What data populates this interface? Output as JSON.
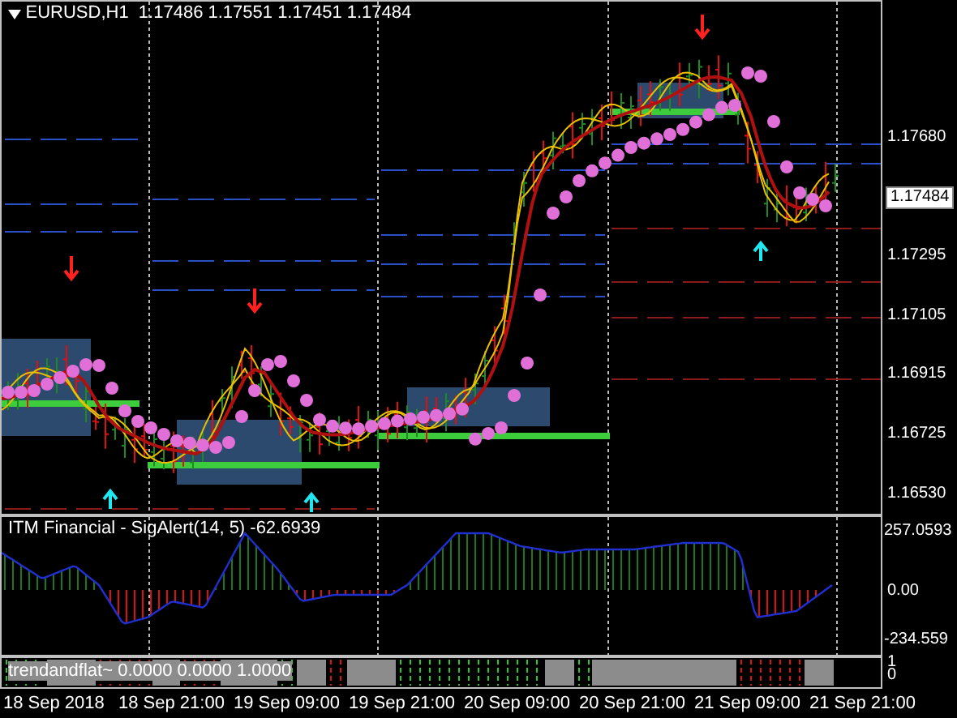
{
  "chart": {
    "title": "EURUSD,H1  1.17486 1.17551 1.17451 1.17484",
    "price_labels": [
      {
        "text": "1.17680",
        "kind": "tick"
      },
      {
        "text": "1.17484",
        "kind": "current"
      },
      {
        "text": "1.17295",
        "kind": "tick"
      },
      {
        "text": "1.17105",
        "kind": "tick"
      },
      {
        "text": "1.16915",
        "kind": "tick"
      },
      {
        "text": "1.16725",
        "kind": "tick"
      },
      {
        "text": "1.16530",
        "kind": "tick"
      }
    ]
  },
  "indicator": {
    "title": "ITM Financial - SigAlert(14, 5) -62.6939",
    "labels": [
      "257.0593",
      "0.00",
      "-234.559"
    ]
  },
  "trend_pane": {
    "title": "trendandflat~ 0.0000 0.0000 1.0000",
    "labels": [
      "1",
      "0"
    ]
  },
  "time_axis": [
    "18 Sep 2018",
    "18 Sep 21:00",
    "19 Sep 09:00",
    "19 Sep 21:00",
    "20 Sep 09:00",
    "20 Sep 21:00",
    "21 Sep 09:00",
    "21 Sep 21:00"
  ]
}
